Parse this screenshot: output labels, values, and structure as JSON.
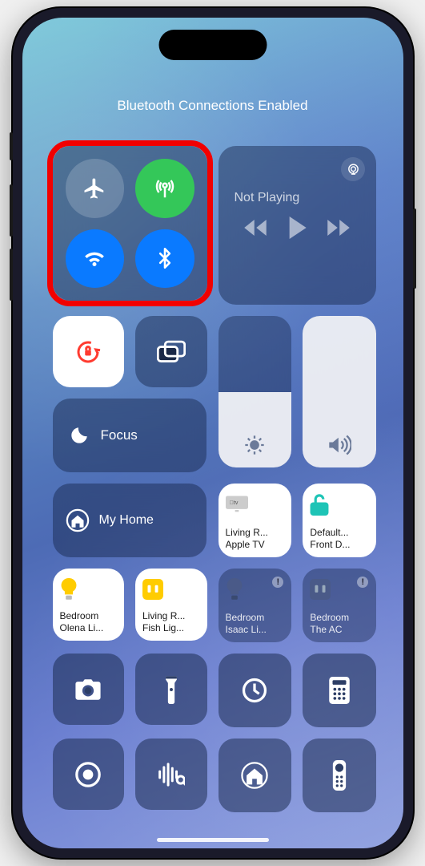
{
  "status_text": "Bluetooth Connections Enabled",
  "connectivity": {
    "airplane": {
      "on": false,
      "color": "rgba(255,255,255,0.18)"
    },
    "cellular": {
      "on": true,
      "color": "#34c759"
    },
    "wifi": {
      "on": true,
      "color": "#0a7aff"
    },
    "bluetooth": {
      "on": true,
      "color": "#0a7aff"
    }
  },
  "media": {
    "title": "Not Playing"
  },
  "focus_label": "Focus",
  "sliders": {
    "brightness": 50,
    "volume": 100
  },
  "home": {
    "label": "My Home"
  },
  "accessory_tiles": [
    {
      "name": "appletv",
      "line1": "Living R...",
      "line2": "Apple TV",
      "white": true,
      "icon": "appletv",
      "badge": false
    },
    {
      "name": "lock",
      "line1": "Default...",
      "line2": "Front D...",
      "white": true,
      "icon": "lock",
      "badge": false
    },
    {
      "name": "bulb1",
      "line1": "Bedroom",
      "line2": "Olena Li...",
      "white": true,
      "icon": "bulb-yellow",
      "badge": false
    },
    {
      "name": "bulb2",
      "line1": "Living R...",
      "line2": "Fish Lig...",
      "white": true,
      "icon": "plug-yellow",
      "badge": false
    },
    {
      "name": "bulb3",
      "line1": "Bedroom",
      "line2": "Isaac Li...",
      "white": false,
      "icon": "bulb-dim",
      "badge": true
    },
    {
      "name": "ac",
      "line1": "Bedroom",
      "line2": "The AC",
      "white": false,
      "icon": "plug-dim",
      "badge": true
    }
  ],
  "utility_buttons": [
    "camera",
    "flashlight",
    "timer",
    "calculator",
    "record",
    "shazam",
    "home",
    "remote"
  ]
}
